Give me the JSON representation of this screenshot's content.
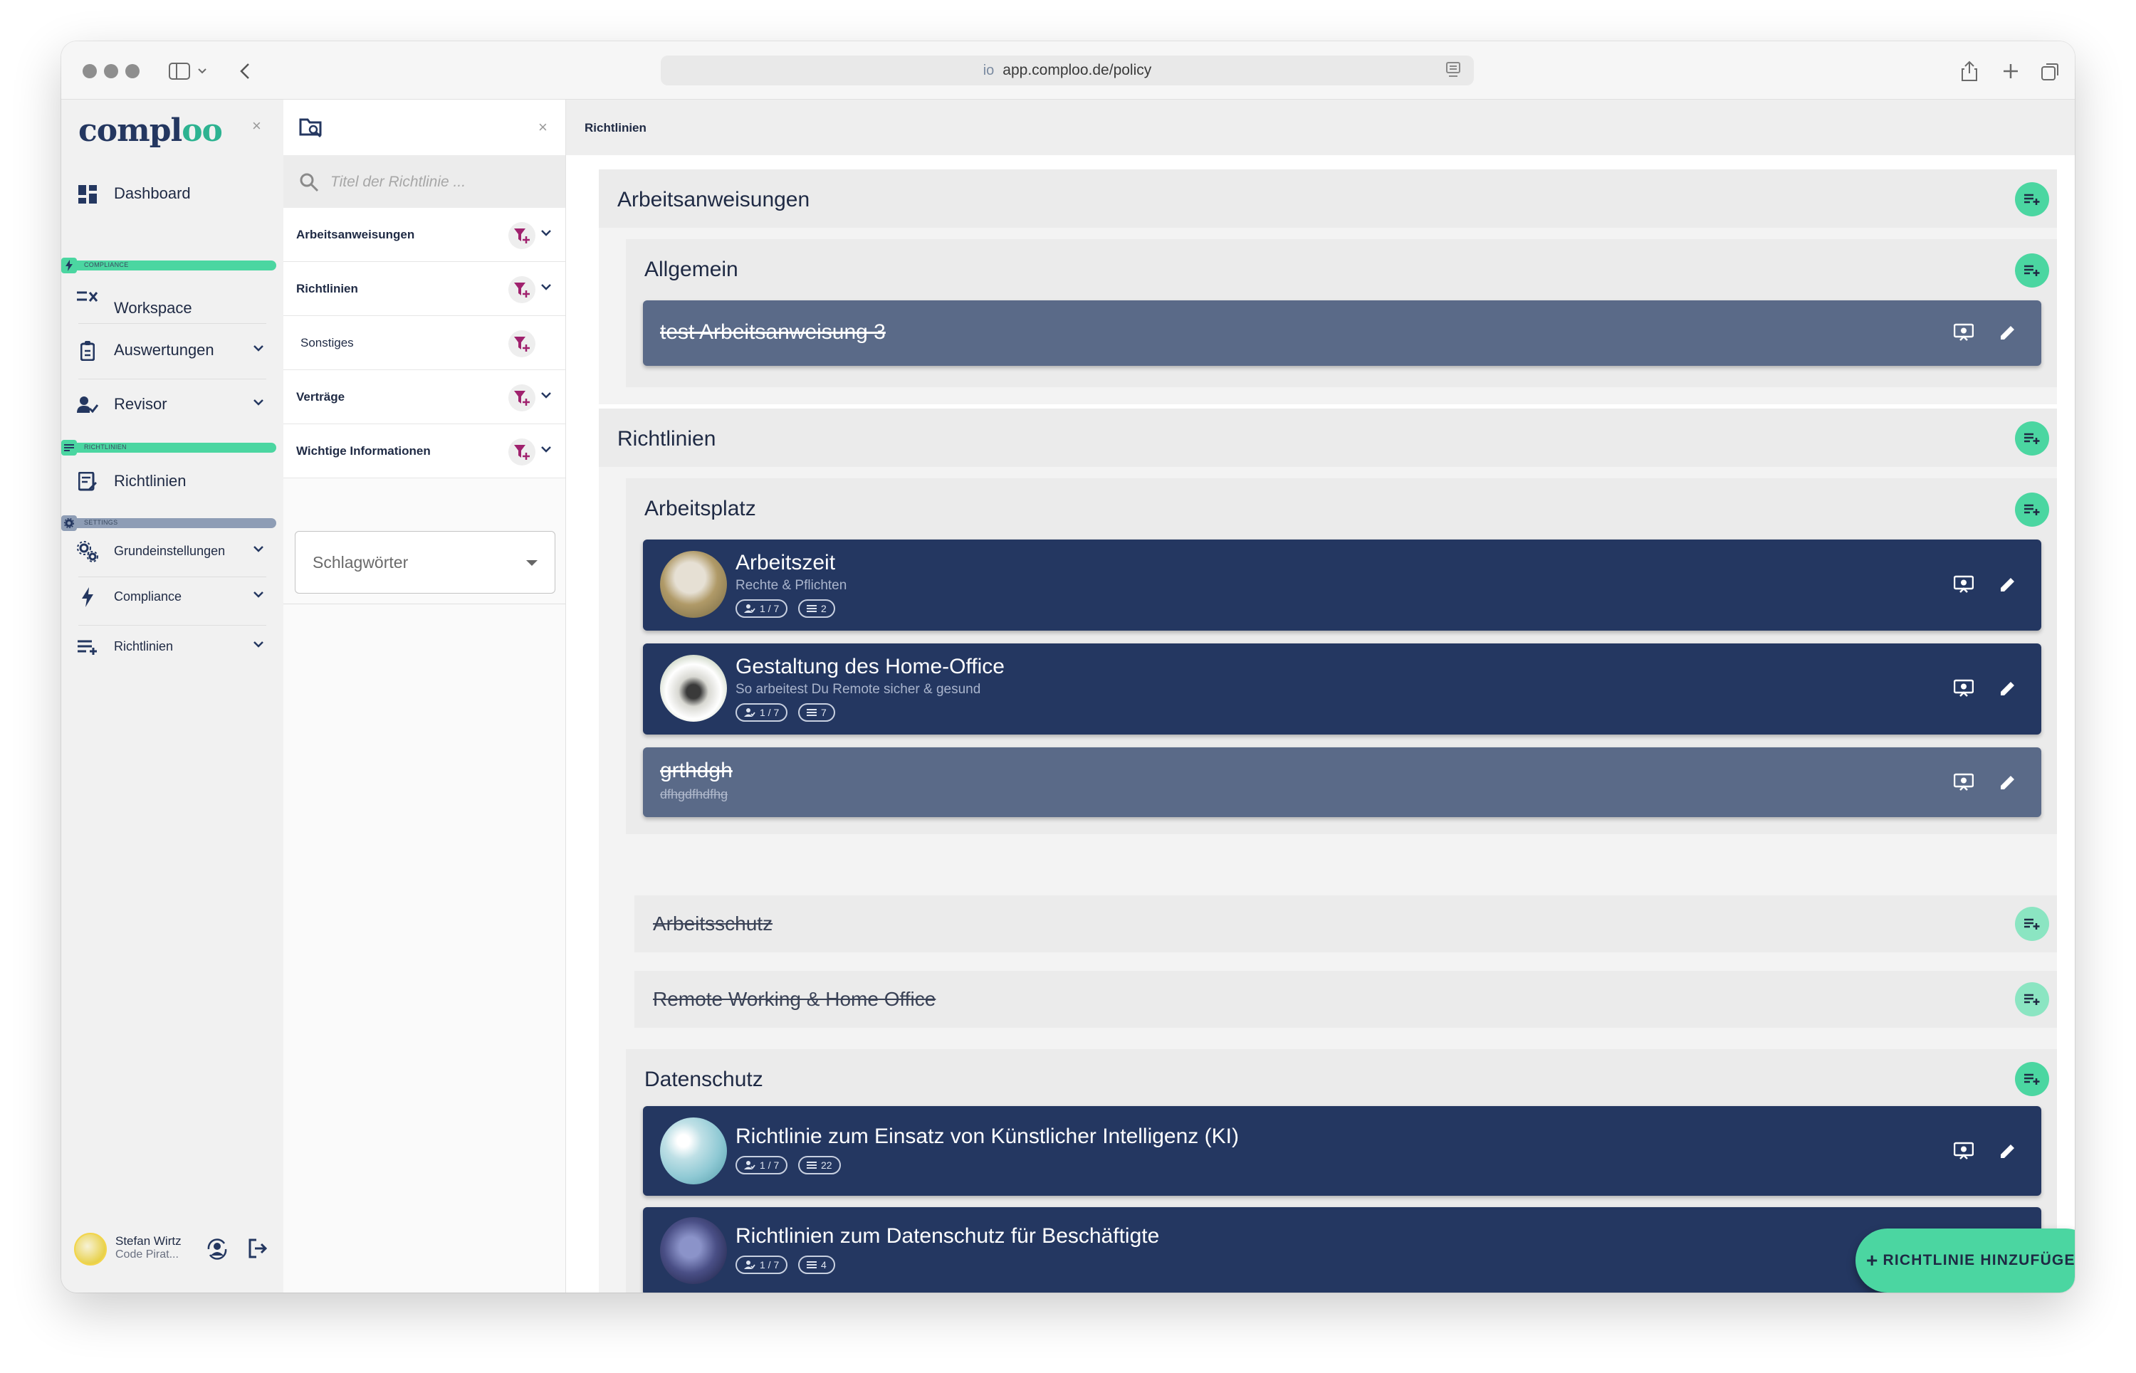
{
  "browser": {
    "url_prefix": "io",
    "url": "app.comploo.de/policy"
  },
  "colors": {
    "accent": "#4bd6a1",
    "navy": "#243761",
    "disabled_card": "#5a6a88",
    "section_compliance": "#4bd6a1",
    "section_settings": "#8e9db5"
  },
  "nav": {
    "logo_prefix": "compl",
    "logo_suffix": "oo",
    "close": "×",
    "sections": {
      "compliance": "COMPLIANCE",
      "richtlinien": "RICHTLINIEN",
      "settings": "SETTINGS"
    },
    "items": {
      "dashboard": "Dashboard",
      "workspace": "Workspace",
      "auswertungen": "Auswertungen",
      "revisor": "Revisor",
      "richtlinien": "Richtlinien",
      "grundeinstellungen": "Grundeinstellungen",
      "compliance": "Compliance",
      "richtlinien_settings": "Richtlinien"
    },
    "user": {
      "name": "Stefan Wirtz",
      "role": "Code Pirat..."
    }
  },
  "filter": {
    "close": "×",
    "search_placeholder": "Titel der Richtlinie ...",
    "rows": {
      "arbeitsanweisungen": "Arbeitsanweisungen",
      "richtlinien": "Richtlinien",
      "sonstiges": "Sonstiges",
      "vertraege": "Verträge",
      "wichtige": "Wichtige Informationen"
    },
    "tags_label": "Schlagwörter"
  },
  "main": {
    "breadcrumb": "Richtlinien",
    "cat_arbeitsanweisungen": "Arbeitsanweisungen",
    "sub_allgemein": "Allgemein",
    "card_test": {
      "title": "test Arbeitsanweisung 3"
    },
    "cat_richtlinien": "Richtlinien",
    "sub_arbeitsplatz": "Arbeitsplatz",
    "card_arbeitszeit": {
      "title": "Arbeitszeit",
      "subtitle": "Rechte & Pflichten",
      "users": "1 / 7",
      "items": "2"
    },
    "card_homeoffice": {
      "title": "Gestaltung des Home-Office",
      "subtitle": "So arbeitest Du Remote sicher & gesund",
      "users": "1 / 7",
      "items": "7"
    },
    "card_grthdgh": {
      "title": "grthdgh",
      "subtitle": "dfhgdfhdfhg"
    },
    "sub_arbeitsschutz": "Arbeitsschutz",
    "sub_remote": "Remote Working & Home Office",
    "sub_datenschutz": "Datenschutz",
    "card_ki": {
      "title": "Richtlinie zum Einsatz von Künstlicher Intelligenz (KI)",
      "users": "1 / 7",
      "items": "22"
    },
    "card_datenschutz": {
      "title": "Richtlinien zum Datenschutz für Beschäftigte",
      "users": "1 / 7",
      "items": "4"
    }
  },
  "fab": {
    "plus": "+",
    "label": "RICHTLINIE HINZUFÜGEN"
  }
}
